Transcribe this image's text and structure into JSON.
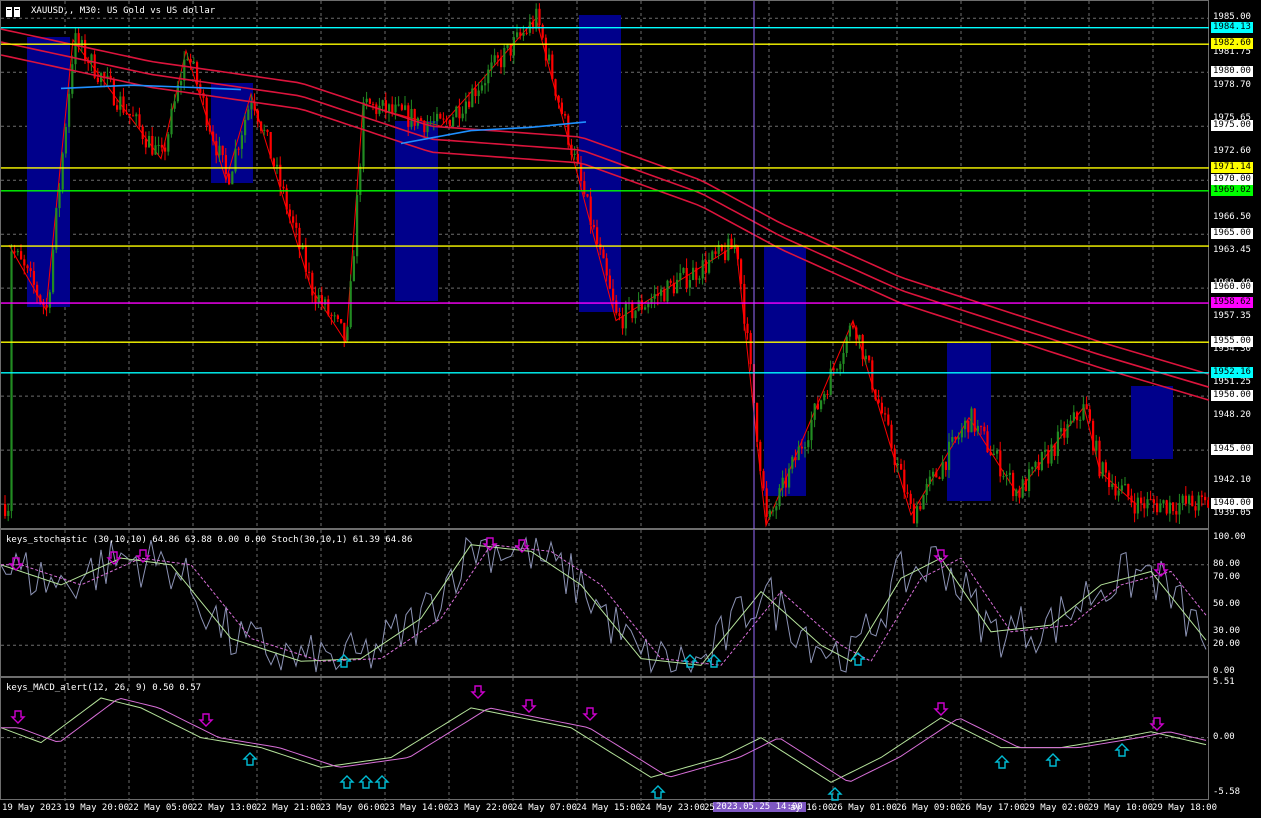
{
  "header": {
    "title": "XAUUSD,, M30:  US Gold vs US dollar"
  },
  "stoch_title": "keys_stochastic (30,10,10) 64.86 63.88 0.00 0.00 Stoch(30,10,1) 61.39 64.86",
  "macd_title": "keys_MACD_alert(12, 26, 9) 0.50 0.57",
  "cursor_time": "2023.05.25 14:00",
  "time_labels": [
    "19 May 2023",
    "19 May 20:00",
    "22 May 05:00",
    "22 May 13:00",
    "22 May 21:00",
    "23 May 06:00",
    "23 May 14:00",
    "23 May 22:00",
    "24 May 07:00",
    "24 May 15:00",
    "24 May 23:00",
    "25",
    "ay 16:00",
    "26 May 01:00",
    "26 May 09:00",
    "26 May 17:00",
    "29 May 02:00",
    "29 May 10:00",
    "29 May 18:00"
  ],
  "price_axis": [
    "1985.00",
    "1981.75",
    "1978.70",
    "1975.65",
    "1972.60",
    "1969.55",
    "1966.50",
    "1963.45",
    "1960.40",
    "1957.35",
    "1954.30",
    "1951.25",
    "1948.20",
    "1945.00",
    "1942.10",
    "1939.05"
  ],
  "price_axis_boxed": [
    {
      "text": "1984.13",
      "color": "#00ffff"
    },
    {
      "text": "1982.60",
      "color": "#ffff00"
    },
    {
      "text": "1980.00",
      "color": "#ffffff"
    },
    {
      "text": "1975.00",
      "color": "#ffffff"
    },
    {
      "text": "1971.14",
      "color": "#ffff00"
    },
    {
      "text": "1970.00",
      "color": "#ffffff"
    },
    {
      "text": "1969.02",
      "color": "#00ff00"
    },
    {
      "text": "1965.00",
      "color": "#ffffff"
    },
    {
      "text": "1960.00",
      "color": "#ffffff"
    },
    {
      "text": "1958.62",
      "color": "#ff00ff"
    },
    {
      "text": "1955.00",
      "color": "#ffffff"
    },
    {
      "text": "1952.16",
      "color": "#00ffff"
    },
    {
      "text": "1950.00",
      "color": "#ffffff"
    },
    {
      "text": "1945.00",
      "color": "#ffffff"
    },
    {
      "text": "1940.00",
      "color": "#ffffff"
    }
  ],
  "stoch_axis": [
    "100.00",
    "80.00",
    "70.00",
    "50.00",
    "30.00",
    "20.00",
    "0.00"
  ],
  "macd_axis": [
    "5.51",
    "0.00",
    "-5.58"
  ],
  "colors": {
    "bull": "#228b22",
    "bear": "#ff0000",
    "box": "#00008b",
    "ma": "#dc143c",
    "ma_cyan": "#1e90ff",
    "level_yellow": "#ffff00",
    "level_green": "#00ff00",
    "level_magenta": "#ff00ff",
    "level_cyan": "#00ffff",
    "grid": "#6d6d6d",
    "arrow_down": "#cc00cc",
    "arrow_up": "#00bcd4",
    "zigzag": "#ff0000"
  },
  "chart_data": {
    "type": "candlestick",
    "symbol": "XAUUSD",
    "timeframe": "M30",
    "ylim": [
      1937.6,
      1986.6
    ],
    "levels": [
      {
        "price": 1984.13,
        "color": "cyan"
      },
      {
        "price": 1982.6,
        "color": "yellow"
      },
      {
        "price": 1971.14,
        "color": "yellow"
      },
      {
        "price": 1969.02,
        "color": "green"
      },
      {
        "price": 1963.9,
        "color": "yellow"
      },
      {
        "price": 1958.62,
        "color": "magenta"
      },
      {
        "price": 1955.0,
        "color": "yellow"
      },
      {
        "price": 1952.16,
        "color": "cyan"
      }
    ],
    "swing_points": [
      1964,
      1958,
      1983,
      1972,
      1982,
      1970,
      1978,
      1960,
      1955,
      1977,
      1975,
      1985,
      1970,
      1957,
      1964,
      1938,
      1957,
      1939,
      1948,
      1941,
      1949,
      1943,
      1940
    ],
    "stochastic": {
      "ylim": [
        0,
        100
      ],
      "levels": [
        80,
        20
      ],
      "last_main": 64.86,
      "last_signal": 63.88,
      "last_stoch": 61.39
    },
    "macd": {
      "ylim": [
        -5.58,
        5.51
      ],
      "last_main": 0.5,
      "last_signal": 0.57
    }
  }
}
